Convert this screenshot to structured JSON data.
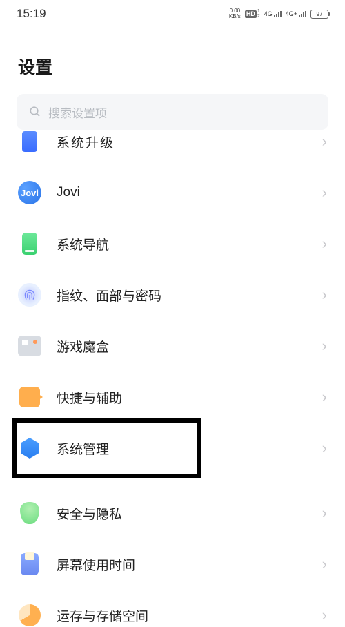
{
  "status": {
    "time": "15:19",
    "speed_top": "0.00",
    "speed_bot": "KB/s",
    "hd": "HD",
    "hd_sub1": "1",
    "hd_sub2": "2",
    "net1": "4G",
    "net2": "4G+",
    "battery": "97"
  },
  "header": {
    "title": "设置"
  },
  "search": {
    "placeholder": "搜索设置项"
  },
  "rows": {
    "upgrade": "系统升级",
    "jovi": "Jovi",
    "nav": "系统导航",
    "finger": "指纹、面部与密码",
    "game": "游戏魔盒",
    "quick": "快捷与辅助",
    "system": "系统管理",
    "security": "安全与隐私",
    "screen": "屏幕使用时间",
    "storage": "运存与存储空间"
  },
  "icons": {
    "jovi_text": "Jovi"
  }
}
